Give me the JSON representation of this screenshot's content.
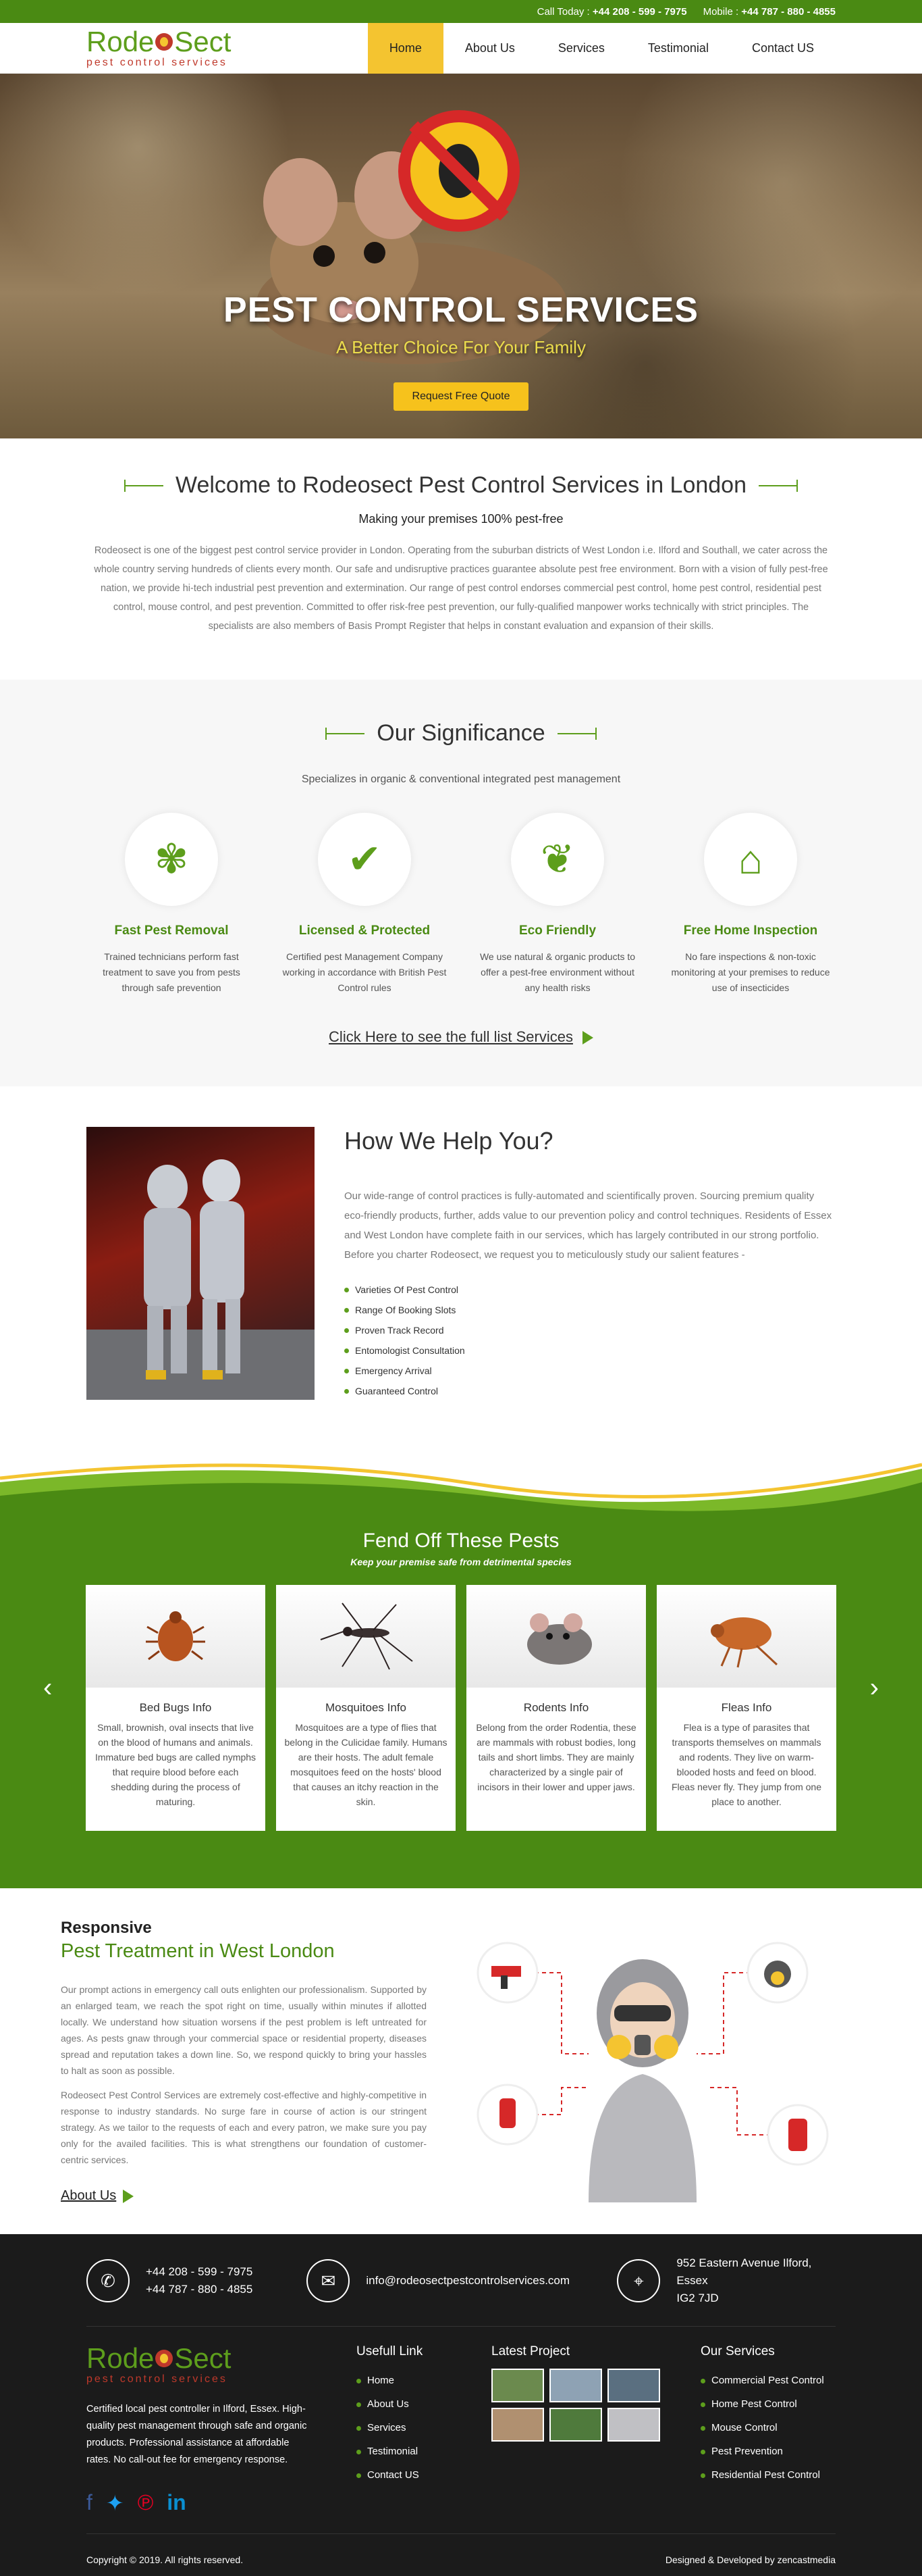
{
  "topbar": {
    "call_label": "Call Today :",
    "call_number": "+44 208 - 599 - 7975",
    "mobile_label": "Mobile :",
    "mobile_number": "+44 787 - 880 - 4855"
  },
  "brand": {
    "name_left": "Rode",
    "name_right": "Sect",
    "tagline": "pest control services"
  },
  "nav": {
    "items": [
      "Home",
      "About Us",
      "Services",
      "Testimonial",
      "Contact US"
    ],
    "active": "Home"
  },
  "hero": {
    "title": "PEST CONTROL SERVICES",
    "subtitle": "A Better Choice For Your Family",
    "button": "Request Free Quote"
  },
  "welcome": {
    "title": "Welcome to Rodeosect Pest Control Services in London",
    "tagline": "Making your premises 100% pest-free",
    "body": "Rodeosect is one of the biggest pest control service provider in London. Operating from the suburban districts of West London i.e. Ilford and Southall, we cater across the whole country serving hundreds of clients every month. Our safe and undisruptive practices guarantee absolute pest free environment. Born with a vision of fully pest-free nation, we provide hi-tech industrial pest prevention and extermination. Our range of pest control endorses commercial pest control, home pest control, residential pest control, mouse control, and pest prevention. Committed to offer risk-free pest prevention, our fully-qualified manpower works technically with strict principles. The specialists are also members of Basis Prompt Register that helps in constant evaluation and expansion of their skills."
  },
  "significance": {
    "title": "Our Significance",
    "tagline": "Specializes in organic & conventional integrated pest management",
    "features": [
      {
        "title": "Fast Pest Removal",
        "text": "Trained technicians perform fast treatment to save you from pests through safe prevention",
        "icon": "bee-icon"
      },
      {
        "title": "Licensed & Protected",
        "text": "Certified pest Management Company working in accordance with British Pest Control rules",
        "icon": "check-badge-icon"
      },
      {
        "title": "Eco Friendly",
        "text": "We use natural & organic products to offer a pest-free environment without any health risks",
        "icon": "leaf-icon"
      },
      {
        "title": "Free Home Inspection",
        "text": "No fare inspections & non-toxic monitoring at your premises to reduce use of insecticides",
        "icon": "home-search-icon"
      }
    ],
    "link": "Click Here to see the full list Services"
  },
  "help": {
    "title": "How We Help You?",
    "body": "Our wide-range of control practices is fully-automated and scientifically proven. Sourcing premium quality eco-friendly products, further, adds value to our prevention policy and control techniques. Residents of Essex and West London have complete faith in our services, which has largely contributed in our strong portfolio. Before you charter Rodeosect, we request you to meticulously study our salient features -",
    "list": [
      "Varieties Of Pest Control",
      "Range Of Booking Slots",
      "Proven Track Record",
      "Entomologist Consultation",
      "Emergency Arrival",
      "Guaranteed Control"
    ]
  },
  "pests": {
    "title": "Fend Off These Pests",
    "tagline": "Keep your premise safe from detrimental species",
    "cards": [
      {
        "title": "Bed Bugs Info",
        "text": "Small, brownish, oval insects that live on the blood of humans and animals. Immature bed bugs are called nymphs that require blood before each shedding during the process of maturing."
      },
      {
        "title": "Mosquitoes Info",
        "text": "Mosquitoes are a type of flies that belong in the Culicidae family. Humans are their hosts. The adult female mosquitoes feed on the hosts' blood that causes an itchy reaction in the skin."
      },
      {
        "title": "Rodents Info",
        "text": "Belong from the order Rodentia, these are mammals with robust bodies, long tails and short limbs. They are mainly characterized by a single pair of incisors in their lower and upper jaws."
      },
      {
        "title": "Fleas Info",
        "text": "Flea is a type of parasites that transports themselves on mammals and rodents. They live on warm-blooded hosts and feed on blood. Fleas never fly. They jump from one place to another."
      }
    ],
    "prev": "‹",
    "next": "›"
  },
  "responsive": {
    "heading": "Responsive",
    "subheading": "Pest Treatment in West London",
    "para1": "Our prompt actions in emergency call outs enlighten our professionalism. Supported by an enlarged team, we reach the spot right on time, usually within minutes if allotted locally. We understand how situation worsens if the pest problem is left untreated for ages. As pests gnaw through your commercial space or residential property, diseases spread and reputation takes a down line. So, we respond quickly to bring your hassles to halt as soon as possible.",
    "para2": "Rodeosect Pest Control Services are extremely cost-effective and highly-competitive in response to industry standards. No surge fare in course of action is our stringent strategy. As we tailor to the requests of each and every patron, we make sure you pay only for the availed facilities. This is what strengthens our foundation of customer-centric services.",
    "link": "About Us"
  },
  "footer": {
    "phone1": "+44 208 - 599 - 7975",
    "phone2": "+44 787 - 880 - 4855",
    "email": "info@rodeosectpestcontrolservices.com",
    "address1": "952 Eastern Avenue Ilford, Essex",
    "address2": "IG2 7JD",
    "about": "Certified local pest controller in Ilford, Essex. High-quality pest management through safe and organic products. Professional assistance at affordable rates. No call-out fee for emergency response.",
    "useful_title": "Usefull Link",
    "useful": [
      "Home",
      "About Us",
      "Services",
      "Testimonial",
      "Contact US"
    ],
    "project_title": "Latest Project",
    "services_title": "Our Services",
    "services": [
      "Commercial Pest Control",
      "Home Pest Control",
      "Mouse Control",
      "Pest Prevention",
      "Residential Pest Control"
    ],
    "copyright": "Copyright © 2019. All rights reserved.",
    "credit_label": "Designed & Developed by",
    "credit_name": "zencastmedia"
  }
}
